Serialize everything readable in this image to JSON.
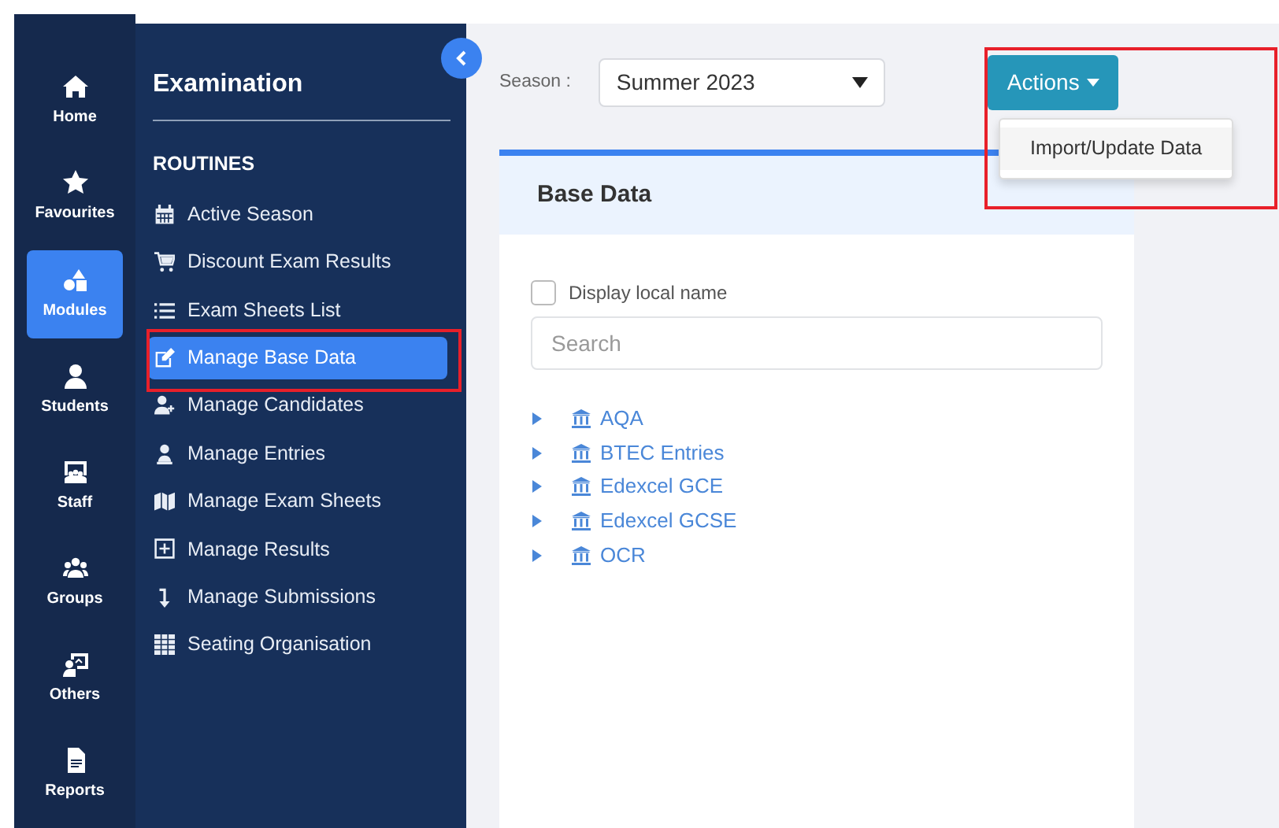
{
  "rail": [
    {
      "label": "Home",
      "selected": false
    },
    {
      "label": "Favourites",
      "selected": false
    },
    {
      "label": "Modules",
      "selected": true
    },
    {
      "label": "Students",
      "selected": false
    },
    {
      "label": "Staff",
      "selected": false
    },
    {
      "label": "Groups",
      "selected": false
    },
    {
      "label": "Others",
      "selected": false
    },
    {
      "label": "Reports",
      "selected": false
    }
  ],
  "menu": {
    "title": "Examination",
    "section": "ROUTINES",
    "items": [
      {
        "label": "Active Season",
        "selected": false
      },
      {
        "label": "Discount Exam Results",
        "selected": false
      },
      {
        "label": "Exam Sheets List",
        "selected": false
      },
      {
        "label": "Manage Base Data",
        "selected": true
      },
      {
        "label": "Manage Candidates",
        "selected": false
      },
      {
        "label": "Manage Entries",
        "selected": false
      },
      {
        "label": "Manage Exam Sheets",
        "selected": false
      },
      {
        "label": "Manage Results",
        "selected": false
      },
      {
        "label": "Manage Submissions",
        "selected": false
      },
      {
        "label": "Seating Organisation",
        "selected": false
      }
    ]
  },
  "toolbar": {
    "season_label": "Season :",
    "season_value": "Summer 2023",
    "actions_button": "Actions",
    "actions_menu": [
      "Import/Update Data"
    ]
  },
  "card": {
    "title": "Base Data",
    "checkbox": {
      "label": "Display local name",
      "checked": false
    },
    "search": {
      "placeholder": "Search"
    },
    "tree": [
      {
        "label": "AQA",
        "expanded": false
      },
      {
        "label": "BTEC Entries",
        "expanded": false
      },
      {
        "label": "Edexcel GCE",
        "expanded": false
      },
      {
        "label": "Edexcel GCSE",
        "expanded": false
      },
      {
        "label": "OCR",
        "expanded": false
      }
    ]
  }
}
